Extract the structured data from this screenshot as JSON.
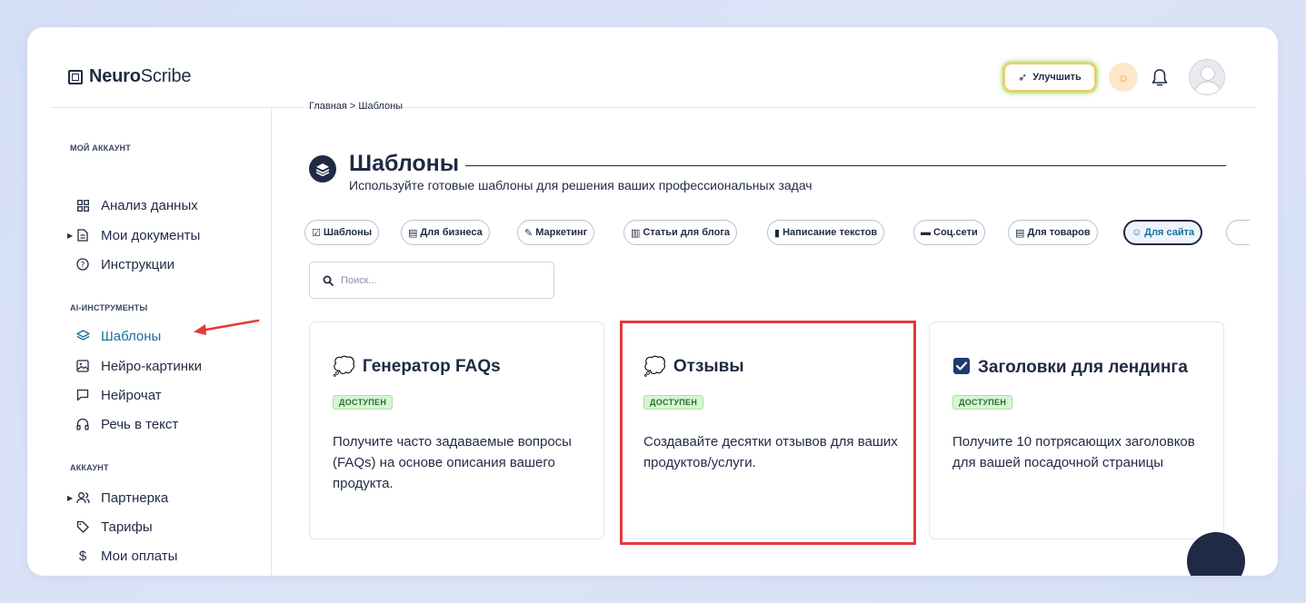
{
  "brand": {
    "bold": "Neuro",
    "regular": "Scribe"
  },
  "header": {
    "upgrade_label": "Улучшить"
  },
  "sidebar": {
    "sections": [
      {
        "title": "МОЙ АККАУНТ"
      },
      {
        "title": "AI-ИНСТРУМЕНТЫ"
      },
      {
        "title": "АККАУНТ"
      }
    ],
    "items": [
      {
        "label": "Анализ данных",
        "icon": "grid-icon"
      },
      {
        "label": "Мои документы",
        "icon": "document-icon"
      },
      {
        "label": "Инструкции",
        "icon": "question-icon"
      },
      {
        "label": "Шаблоны",
        "icon": "layers-icon",
        "active": true
      },
      {
        "label": "Нейро-картинки",
        "icon": "image-icon"
      },
      {
        "label": "Нейрочат",
        "icon": "chat-icon"
      },
      {
        "label": "Речь в текст",
        "icon": "headphones-icon"
      },
      {
        "label": "Партнерка",
        "icon": "users-icon"
      },
      {
        "label": "Тарифы",
        "icon": "tag-icon"
      },
      {
        "label": "Мои оплаты",
        "icon": "dollar-icon"
      }
    ]
  },
  "main": {
    "breadcrumb": "Главная  >  Шаблоны",
    "title": "Шаблоны",
    "subtitle": "Используйте готовые шаблоны для решения ваших профессиональных задач",
    "search_placeholder": "Поиск...",
    "chips": [
      {
        "label": "Шаблоны",
        "icon": "checkbox-icon"
      },
      {
        "label": "Для бизнеса",
        "icon": "folder-icon"
      },
      {
        "label": "Маркетинг",
        "icon": "memo-icon"
      },
      {
        "label": "Статьи для блога",
        "icon": "books-icon"
      },
      {
        "label": "Написание текстов",
        "icon": "phone-icon"
      },
      {
        "label": "Соц.сети",
        "icon": "laptop-icon"
      },
      {
        "label": "Для товаров",
        "icon": "ledger-icon"
      },
      {
        "label": "Для сайта",
        "icon": "mask-icon",
        "active": true
      }
    ],
    "cards": [
      {
        "title": "Генератор FAQs",
        "badge": "ДОСТУПЕН",
        "desc": "Получите часто задаваемые вопросы (FAQs) на основе описания вашего продукта.",
        "icon": "info-bubble-icon"
      },
      {
        "title": "Отзывы",
        "badge": "ДОСТУПЕН",
        "desc": "Создавайте десятки отзывов для ваших продуктов/услуги.",
        "icon": "info-bubble-icon"
      },
      {
        "title": "Заголовки для лендинга",
        "badge": "ДОСТУПЕН",
        "desc": "Получите 10 потрясающих заголовков для вашей посадочной страницы",
        "icon": "checkbox-icon"
      }
    ]
  },
  "colors": {
    "accent": "#1b6f9a",
    "dark": "#1f2a44",
    "annotation": "#e4393c",
    "badge_bg": "#d6f5d2"
  }
}
